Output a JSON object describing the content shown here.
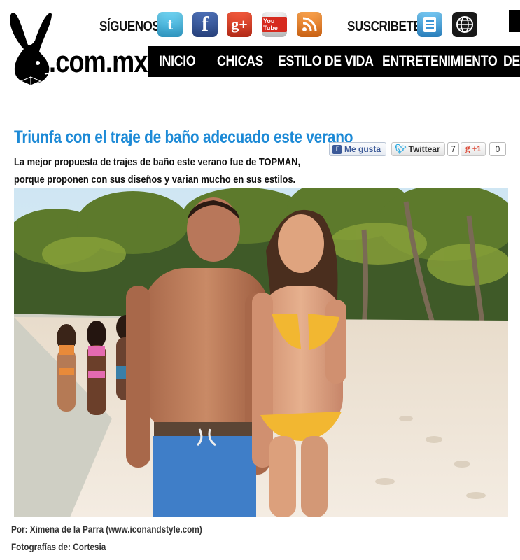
{
  "header": {
    "logo_text": ".com.mx",
    "follow_label": "SÍGUENOS:",
    "subscribe_label": "SUSCRIBETE:",
    "social_icons": [
      "twitter-icon",
      "facebook-icon",
      "google-plus-icon",
      "youtube-icon",
      "rss-icon"
    ],
    "youtube_label": "You Tube",
    "subscribe_icons": [
      "newsletter-icon",
      "globe-icon"
    ]
  },
  "nav": {
    "items": [
      "INICIO",
      "CHICAS",
      "ESTILO DE VIDA",
      "ENTRETENIMIENTO",
      "DE"
    ]
  },
  "article": {
    "headline": "Triunfa con el traje de baño adecuado este verano",
    "lead": "La mejor propuesta de trajes de baño este verano fue de TOPMAN, porque proponen con sus diseños y varian mucho en sus estilos.",
    "byline": "Por: Ximena de la Parra (www.iconandstyle.com)",
    "photo_credit": "Fotografías de: Cortesia"
  },
  "share": {
    "like_label": "Me gusta",
    "tweet_label": "Twittear",
    "tweet_count": "7",
    "gplus_label": "+1",
    "gplus_count": "0"
  },
  "colors": {
    "headline": "#1d8ad6",
    "nav_background": "#000000",
    "facebook": "#3b5998",
    "twitter": "#2aa9e0",
    "google_plus": "#dd4b39"
  }
}
